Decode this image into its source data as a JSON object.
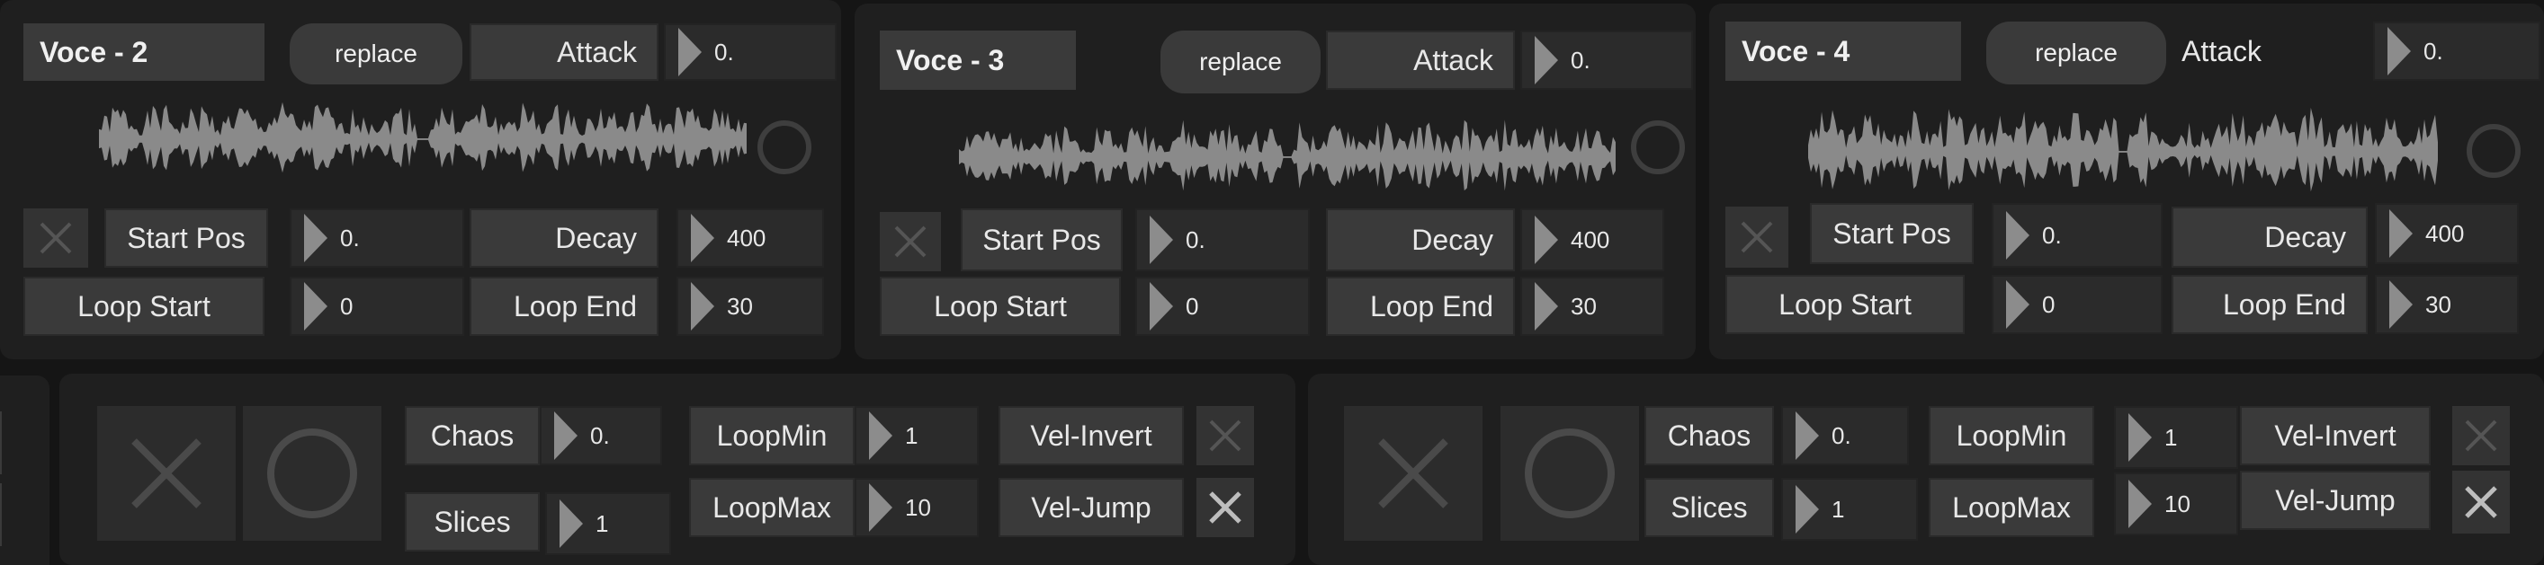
{
  "colors": {
    "background": "#151515",
    "panel": "#1f1f1f",
    "label": "#3a3a3a",
    "number": "#2b2b2b",
    "waveform": "#8a8a8a"
  },
  "voices": [
    {
      "title": "Voce - 2",
      "replace": "replace",
      "attack": {
        "label": "Attack",
        "value": "0."
      },
      "start_pos": {
        "label": "Start Pos",
        "value": "0."
      },
      "decay": {
        "label": "Decay",
        "value": "400"
      },
      "loop_start": {
        "label": "Loop Start",
        "value": "0"
      },
      "loop_end": {
        "label": "Loop End",
        "value": "30"
      }
    },
    {
      "title": "Voce - 3",
      "replace": "replace",
      "attack": {
        "label": "Attack",
        "value": "0."
      },
      "start_pos": {
        "label": "Start Pos",
        "value": "0."
      },
      "decay": {
        "label": "Decay",
        "value": "400"
      },
      "loop_start": {
        "label": "Loop Start",
        "value": "0"
      },
      "loop_end": {
        "label": "Loop End",
        "value": "30"
      }
    },
    {
      "title": "Voce - 4",
      "replace": "replace",
      "attack": {
        "label": "Attack",
        "value": "0."
      },
      "start_pos": {
        "label": "Start Pos",
        "value": "0."
      },
      "decay": {
        "label": "Decay",
        "value": "400"
      },
      "loop_start": {
        "label": "Loop Start",
        "value": "0"
      },
      "loop_end": {
        "label": "Loop End",
        "value": "30"
      }
    }
  ],
  "chaos_panels": [
    {
      "chaos": {
        "label": "Chaos",
        "value": "0."
      },
      "slices": {
        "label": "Slices",
        "value": "1"
      },
      "loopmin": {
        "label": "LoopMin",
        "value": "1"
      },
      "loopmax": {
        "label": "LoopMax",
        "value": "10"
      },
      "vel_invert": "Vel-Invert",
      "vel_jump": "Vel-Jump"
    },
    {
      "chaos": {
        "label": "Chaos",
        "value": "0."
      },
      "slices": {
        "label": "Slices",
        "value": "1"
      },
      "loopmin": {
        "label": "LoopMin",
        "value": "1"
      },
      "loopmax": {
        "label": "LoopMax",
        "value": "10"
      },
      "vel_invert": "Vel-Invert",
      "vel_jump": "Vel-Jump"
    }
  ],
  "icons": [
    "x-icon",
    "circle-icon",
    "play-triangle-icon",
    "waveform"
  ]
}
